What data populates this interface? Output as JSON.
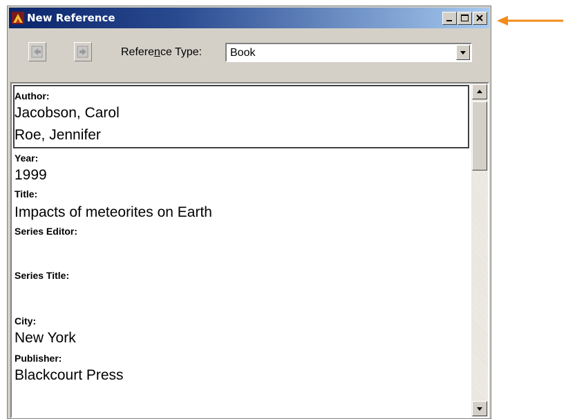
{
  "window": {
    "title": "New Reference",
    "title_gradient_start": "#0a246a",
    "title_gradient_end": "#a6caf0"
  },
  "title_buttons": [
    "minimize-icon",
    "maximize-icon",
    "close-icon"
  ],
  "toolbar": {
    "reference_type_label_pre": "Refere",
    "reference_type_label_accel": "n",
    "reference_type_label_post": "ce Type:",
    "reference_type_value": "Book"
  },
  "fields": [
    {
      "label": "Author:",
      "values": [
        "Jacobson, Carol",
        "Roe, Jennifer"
      ]
    },
    {
      "label": "Year:",
      "values": [
        "1999"
      ]
    },
    {
      "label": "Title:",
      "values": [
        "Impacts of meteorites on Earth"
      ]
    },
    {
      "label": "Series Editor:",
      "values": []
    },
    {
      "label": "Series Title:",
      "values": []
    },
    {
      "label": "City:",
      "values": [
        "New York"
      ]
    },
    {
      "label": "Publisher:",
      "values": [
        "Blackcourt Press"
      ]
    }
  ],
  "annotation_color": "#f28c1a"
}
